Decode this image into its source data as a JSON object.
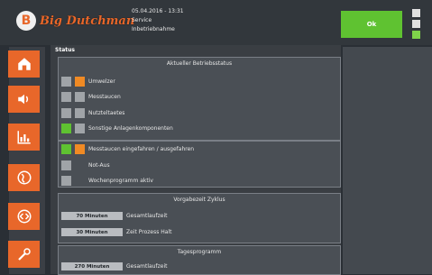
{
  "header": {
    "date_time": "05.04.2016 - 13:31",
    "line2": "Service",
    "line3": "Inbetriebnahme",
    "ok_label": "Ok"
  },
  "logo": {
    "text": "Big Dutchman",
    "badge": "B"
  },
  "main": {
    "status_title": "Status",
    "panels": [
      {
        "title": "Aktueller Betriebsstatus",
        "rows": [
          {
            "label": "Umwelzer"
          },
          {
            "label": "Messtaucen"
          },
          {
            "label": "Nutzteltaetes"
          },
          {
            "label": "Sonstige Anlagenkomponenten"
          }
        ]
      },
      {
        "title": "",
        "rows": [
          {
            "label": "Messtaucen eingefahren / ausgefahren"
          },
          {
            "label": "Not-Aus"
          },
          {
            "label": "Wochenprogramm aktiv"
          }
        ]
      },
      {
        "title": "Vorgabezeit Zyklus",
        "values": [
          {
            "value": "70 Minuten",
            "label": "Gesamtlaufzeit"
          },
          {
            "value": "30 Minuten",
            "label": "Zeit Prozess Halt"
          }
        ]
      },
      {
        "title": "Tagesprogramm",
        "values": [
          {
            "value": "270 Minuten",
            "label": "Gesamtlaufzeit"
          }
        ]
      }
    ]
  },
  "colors": {
    "accent": "#e8672a",
    "ok": "#5fc231",
    "indicator_orange": "#f08a24"
  }
}
